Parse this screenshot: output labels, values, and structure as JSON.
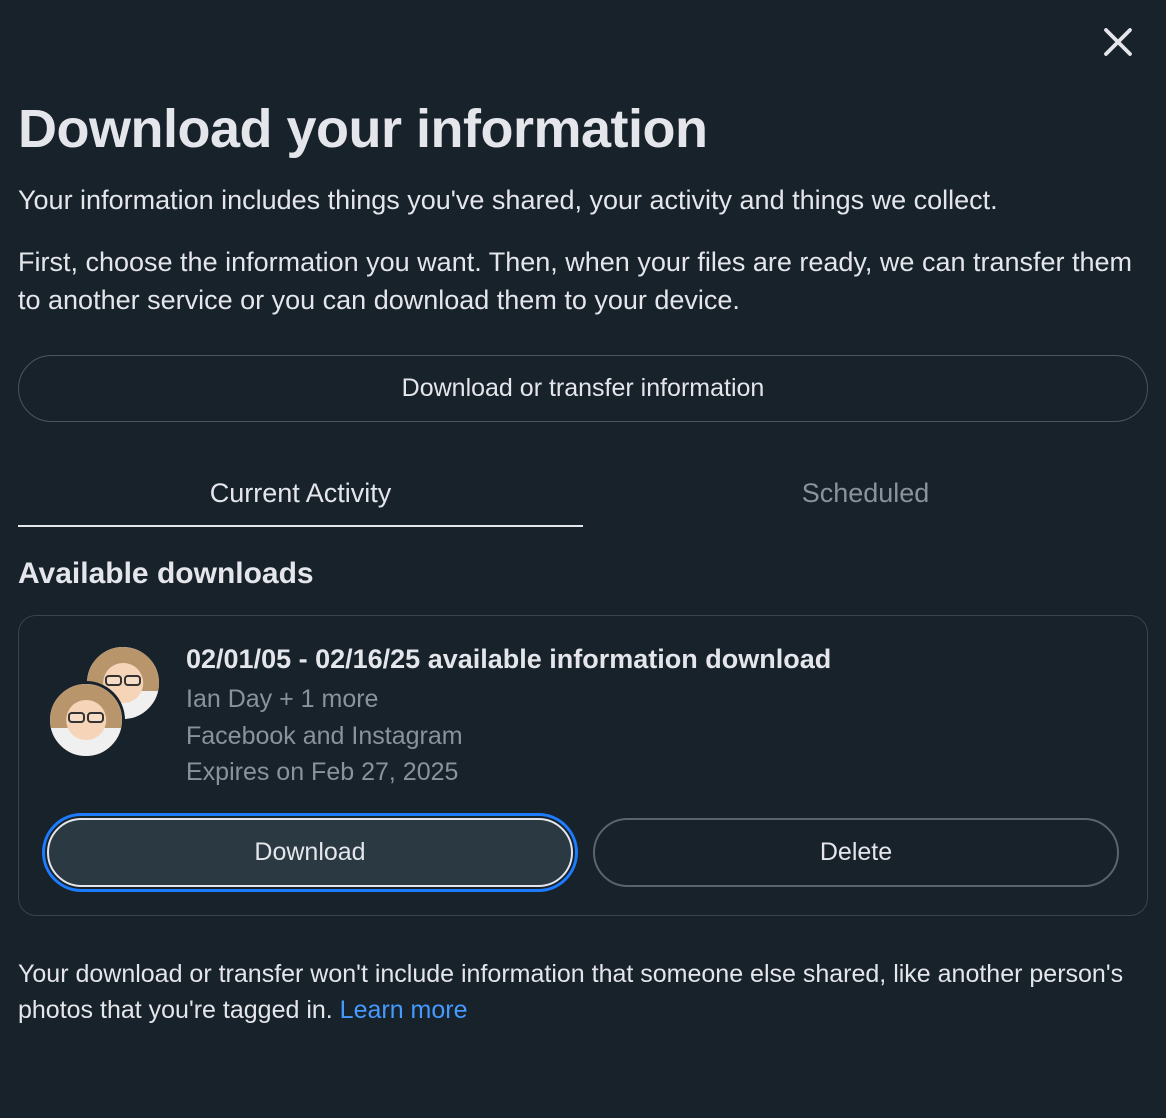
{
  "header": {
    "title": "Download your information",
    "subtitle": "Your information includes things you've shared, your activity and things we collect.",
    "description": "First, choose the information you want. Then, when your files are ready, we can transfer them to another service or you can download them to your device."
  },
  "buttons": {
    "download_transfer": "Download or transfer information",
    "download": "Download",
    "delete": "Delete"
  },
  "tabs": {
    "current": "Current Activity",
    "scheduled": "Scheduled"
  },
  "section": {
    "available_downloads": "Available downloads"
  },
  "download_item": {
    "title": "02/01/05 - 02/16/25 available information download",
    "account": "Ian Day + 1 more",
    "services": "Facebook and Instagram",
    "expiry": "Expires on Feb 27, 2025"
  },
  "footer": {
    "text": "Your download or transfer won't include information that someone else shared, like another person's photos that you're tagged in. ",
    "learn_more": "Learn more"
  }
}
